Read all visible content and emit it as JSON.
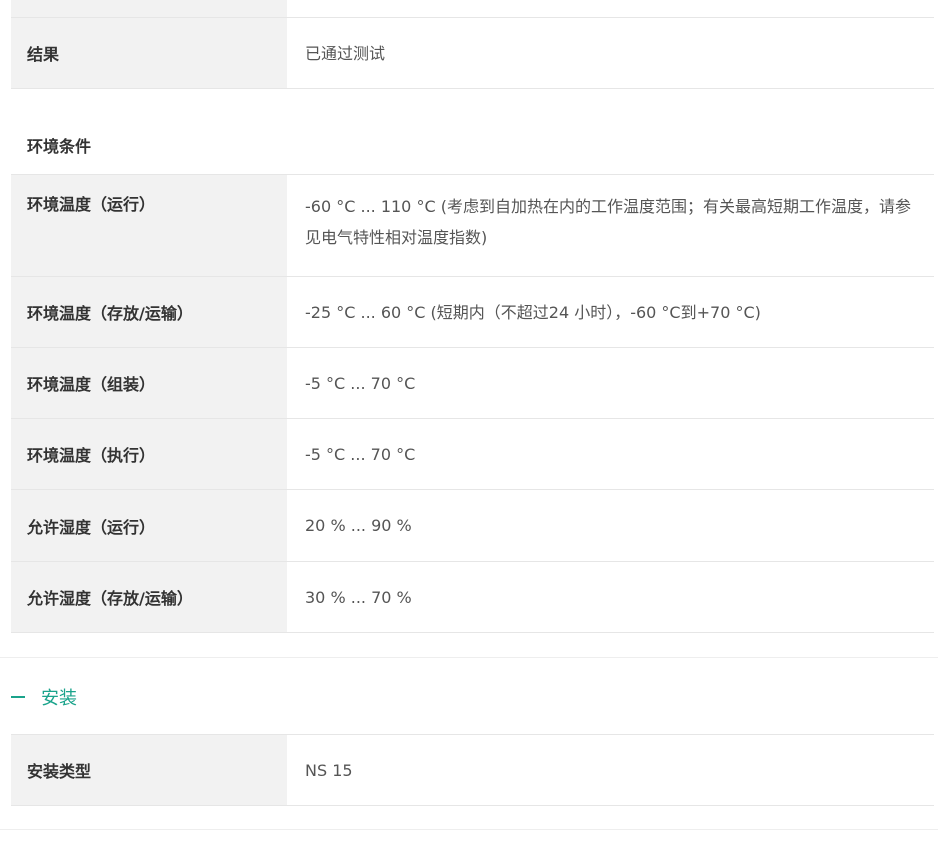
{
  "top_table": [
    {
      "label": "结果",
      "value": "已通过测试"
    }
  ],
  "env_heading": "环境条件",
  "env_table": [
    {
      "label": "环境温度（运行）",
      "value": "-60 °C ... 110 °C (考虑到自加热在内的工作温度范围；有关最高短期工作温度，请参见电气特性相对温度指数)"
    },
    {
      "label": "环境温度（存放/运输）",
      "value": "-25 °C ... 60 °C (短期内（不超过24  小时），-60 °C到+70 °C)"
    },
    {
      "label": "环境温度（组装）",
      "value": "-5 °C ... 70 °C"
    },
    {
      "label": "环境温度（执行）",
      "value": "-5 °C ... 70 °C"
    },
    {
      "label": "允许湿度（运行）",
      "value": "20 % ... 90 %"
    },
    {
      "label": "允许湿度（存放/运输）",
      "value": "30 % ... 70 %"
    }
  ],
  "install_section": {
    "label": "安装",
    "icon": "minus-icon",
    "accent": "#1aa38b"
  },
  "install_table": [
    {
      "label": "安装类型",
      "value": "NS 15"
    }
  ]
}
